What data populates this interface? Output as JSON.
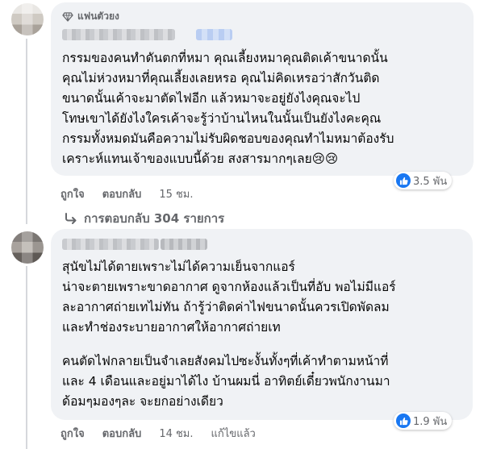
{
  "comment1": {
    "badge": "แฟนตัวยง",
    "text": "กรรมของคนทำดันตกที่หมา คุณเลี้ยงหมาคุณติดเค้าขนาดนั้น\nคุณไม่ห่วงหมาที่คุณเลี้ยงเลยหรอ คุณไม่คิดเหรอว่าสักวันติด\nขนาดนั้นเค้าจะมาตัดไฟอีก แล้วหมาจะอยู่ยังไง￼คุณจะไป\nโทษเขาได้ยังไงใครเค้าจะรู้ว่าบ้านไหนในนั้นเป็นยังไงคะคุณ￼\nกรรมทั้งหมดมันคือความไม่รับผิดชอบของคุณทำไมหมาต้องรับ\nเคราะห์แทนเจ้าของแบบนี้ด้วย สงสารมากๆเลย😢😢￼",
    "reaction_count": "3.5 พัน",
    "actions": {
      "like": "ถูกใจ",
      "reply": "ตอบกลับ",
      "time": "15 ชม."
    },
    "replies_link": "การตอบกลับ 304 รายการ"
  },
  "comment2": {
    "paragraph1": "สุนัขไม่ได้ตายเพราะไม่ได้ความเย็นจากแอร์\nน่าจะตายเพราะขาดอากาศ ดูจากห้องแล้วเป็นที่อับ พอไม่มีแอร์\nละอากาศถ่ายเทไม่ทัน ถ้ารู้ว่าติดค่าไฟขนาดนั้นควรเปิดพัดลม\nและทำช่องระบายอากาศให้อากาศถ่ายเท",
    "paragraph2": "คนตัดไฟกลายเป็นจำเลยสังคมไปซะงั้นทั้งๆที่เค้าทำตามหน้าที่\nและ 4 เดือนและอยู่มาได้ไง บ้านผมนี่ อาทิตย์เดี๋ยวพนักงานมา\nด้อมๆมองๆละ จะยกอย่างเดียว",
    "reaction_count": "1.9 พัน",
    "actions": {
      "like": "ถูกใจ",
      "reply": "ตอบกลับ",
      "time": "14 ชม.",
      "edited": "แก้ไขแล้ว"
    }
  },
  "colors": {
    "bubble": "#f0f2f5",
    "like": "#1877f2",
    "meta": "#65676b"
  }
}
